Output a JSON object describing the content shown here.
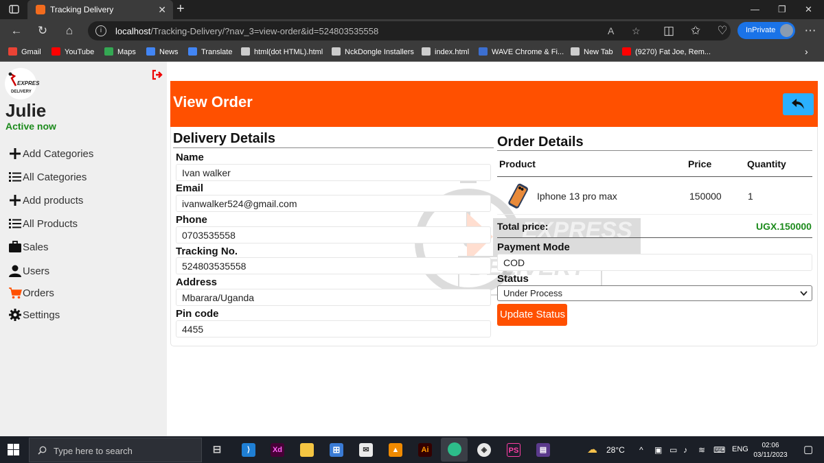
{
  "browser": {
    "tab_title": "Tracking Delivery",
    "url_host": "localhost",
    "url_path": "/Tracking-Delivery/?nav_3=view-order&id=524803535558",
    "inprivate_label": "InPrivate",
    "bookmarks": [
      {
        "label": "Gmail",
        "color": "#ea4335"
      },
      {
        "label": "YouTube",
        "color": "#ff0000"
      },
      {
        "label": "Maps",
        "color": "#34a853"
      },
      {
        "label": "News",
        "color": "#4285f4"
      },
      {
        "label": "Translate",
        "color": "#4285f4"
      },
      {
        "label": "html(dot HTML).html",
        "color": "#cccccc"
      },
      {
        "label": "NckDongle Installers",
        "color": "#cccccc"
      },
      {
        "label": "index.html",
        "color": "#cccccc"
      },
      {
        "label": "WAVE Chrome & Fi...",
        "color": "#3c6fd1"
      },
      {
        "label": "New Tab",
        "color": "#cccccc"
      },
      {
        "label": "(9270) Fat Joe, Rem...",
        "color": "#ff0000"
      }
    ]
  },
  "sidebar": {
    "logo_text_top": "EXPRES",
    "logo_text_bottom": "DELIVERY",
    "user_name": "Julie",
    "status": "Active now",
    "items": [
      {
        "label": "Add Categories",
        "icon": "plus-icon"
      },
      {
        "label": "All Categories",
        "icon": "list-icon"
      },
      {
        "label": "Add products",
        "icon": "plus-icon"
      },
      {
        "label": "All Products",
        "icon": "list-icon"
      },
      {
        "label": "Sales",
        "icon": "briefcase-icon"
      },
      {
        "label": "Users",
        "icon": "user-icon"
      },
      {
        "label": "Orders",
        "icon": "cart-icon"
      },
      {
        "label": "Settings",
        "icon": "gear-icon"
      }
    ]
  },
  "header": {
    "title": "View Order"
  },
  "watermark": {
    "line1": "EXPRESS",
    "line2": "DELIVERY"
  },
  "delivery": {
    "heading": "Delivery Details",
    "fields": [
      {
        "label": "Name",
        "value": "Ivan walker"
      },
      {
        "label": "Email",
        "value": "ivanwalker524@gmail.com"
      },
      {
        "label": "Phone",
        "value": "0703535558"
      },
      {
        "label": "Tracking No.",
        "value": "524803535558"
      },
      {
        "label": "Address",
        "value": "Mbarara/Uganda"
      },
      {
        "label": "Pin code",
        "value": "4455"
      }
    ]
  },
  "order": {
    "heading": "Order Details",
    "columns": [
      "Product",
      "Price",
      "Quantity"
    ],
    "rows": [
      {
        "product": "Iphone 13 pro max",
        "price": "150000",
        "quantity": "1"
      }
    ],
    "total_label": "Total price:",
    "total_value": "UGX.150000",
    "payment_label": "Payment Mode",
    "payment_value": "COD",
    "status_label": "Status",
    "status_value": "Under Process",
    "update_button": "Update Status"
  },
  "taskbar": {
    "search_placeholder": "Type here to search",
    "temperature": "28°C",
    "language": "ENG",
    "time": "02:06",
    "date": "03/11/2023"
  },
  "colors": {
    "accent": "#ff5000",
    "back_button": "#2ab0ff",
    "active_green": "#1b8a1b",
    "sidebar_bg": "#efefef"
  }
}
